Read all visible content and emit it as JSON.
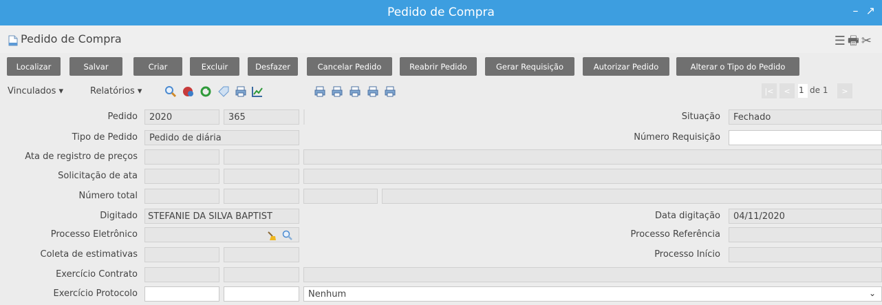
{
  "window": {
    "title": "Pedido de Compra",
    "minimize": "–",
    "maximize": "↗"
  },
  "header": {
    "title": "Pedido de Compra",
    "menu_icon": "menu-icon",
    "print_icon": "print-icon",
    "tools_icon": "tools-icon"
  },
  "toolbar": {
    "buttons": [
      "Localizar",
      "Salvar",
      "Criar",
      "Excluir",
      "Desfazer",
      "Cancelar Pedido",
      "Reabrir Pedido",
      "Gerar Requisição",
      "Autorizar Pedido",
      "Alterar o Tipo do Pedido"
    ]
  },
  "iconbar": {
    "vinculados": "Vinculados ▾",
    "relatorios": "Relatórios ▾",
    "pager": {
      "current": "1",
      "of": "de 1",
      "first": "|<",
      "prev": "<",
      "next": ">"
    }
  },
  "form": {
    "pedido": {
      "label": "Pedido",
      "year": "2020",
      "number": "365"
    },
    "situacao": {
      "label": "Situação",
      "value": "Fechado"
    },
    "tipo": {
      "label": "Tipo de Pedido",
      "value": "Pedido de diária"
    },
    "numero_requisicao": {
      "label": "Número Requisição",
      "value": ""
    },
    "ata": {
      "label": "Ata de registro de preços"
    },
    "solicitacao": {
      "label": "Solicitação de ata"
    },
    "numero_total": {
      "label": "Número total"
    },
    "digitado": {
      "label": "Digitado",
      "value": "STEFANIE DA SILVA BAPTIST"
    },
    "data_digitacao": {
      "label": "Data digitação",
      "value": "04/11/2020"
    },
    "processo_eletronico": {
      "label": "Processo Eletrônico"
    },
    "processo_referencia": {
      "label": "Processo Referência"
    },
    "coleta": {
      "label": "Coleta de estimativas"
    },
    "processo_inicio": {
      "label": "Processo Início"
    },
    "exercicio_contrato": {
      "label": "Exercício Contrato"
    },
    "exercicio_protocolo": {
      "label": "Exercício Protocolo",
      "select_value": "Nenhum"
    }
  }
}
